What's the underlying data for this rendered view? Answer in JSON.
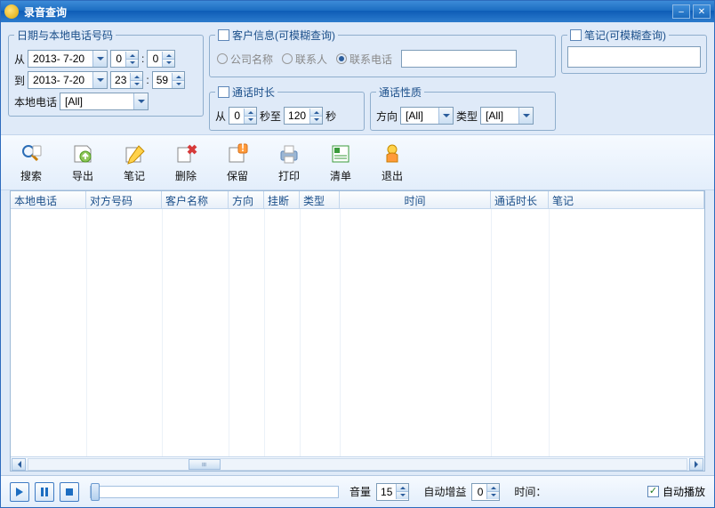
{
  "title": "录音查询",
  "filters": {
    "date_group": "日期与本地电话号码",
    "from_lbl": "从",
    "to_lbl": "到",
    "date_from": "2013- 7-20",
    "date_to": "2013- 7-20",
    "hour_from": "0",
    "min_from": "0",
    "hour_to": "23",
    "min_to": "59",
    "local_phone_lbl": "本地电话",
    "local_phone_val": "[All]",
    "customer_group": "客户信息(可模糊查询)",
    "radio_company": "公司名称",
    "radio_contact": "联系人",
    "radio_phone": "联系电话",
    "customer_value": "",
    "duration_group": "通话时长",
    "dur_from_lbl": "从",
    "dur_from": "0",
    "dur_sec1": "秒至",
    "dur_to": "120",
    "dur_sec2": "秒",
    "nature_group": "通话性质",
    "direction_lbl": "方向",
    "direction_val": "[All]",
    "type_lbl": "类型",
    "type_val": "[All]",
    "notes_group": "笔记(可模糊查询)",
    "notes_value": ""
  },
  "toolbar": {
    "search": "搜索",
    "export": "导出",
    "notes": "笔记",
    "delete": "删除",
    "keep": "保留",
    "print": "打印",
    "list": "清单",
    "exit": "退出"
  },
  "columns": {
    "local_phone": "本地电话",
    "remote_number": "对方号码",
    "customer_name": "客户名称",
    "direction": "方向",
    "hangup": "挂断",
    "type": "类型",
    "time": "时间",
    "duration": "通话时长",
    "notes": "笔记"
  },
  "player": {
    "volume_lbl": "音量",
    "volume": "15",
    "auto_gain_lbl": "自动增益",
    "auto_gain": "0",
    "time_lbl": "时间：",
    "autoplay_lbl": "自动播放"
  }
}
